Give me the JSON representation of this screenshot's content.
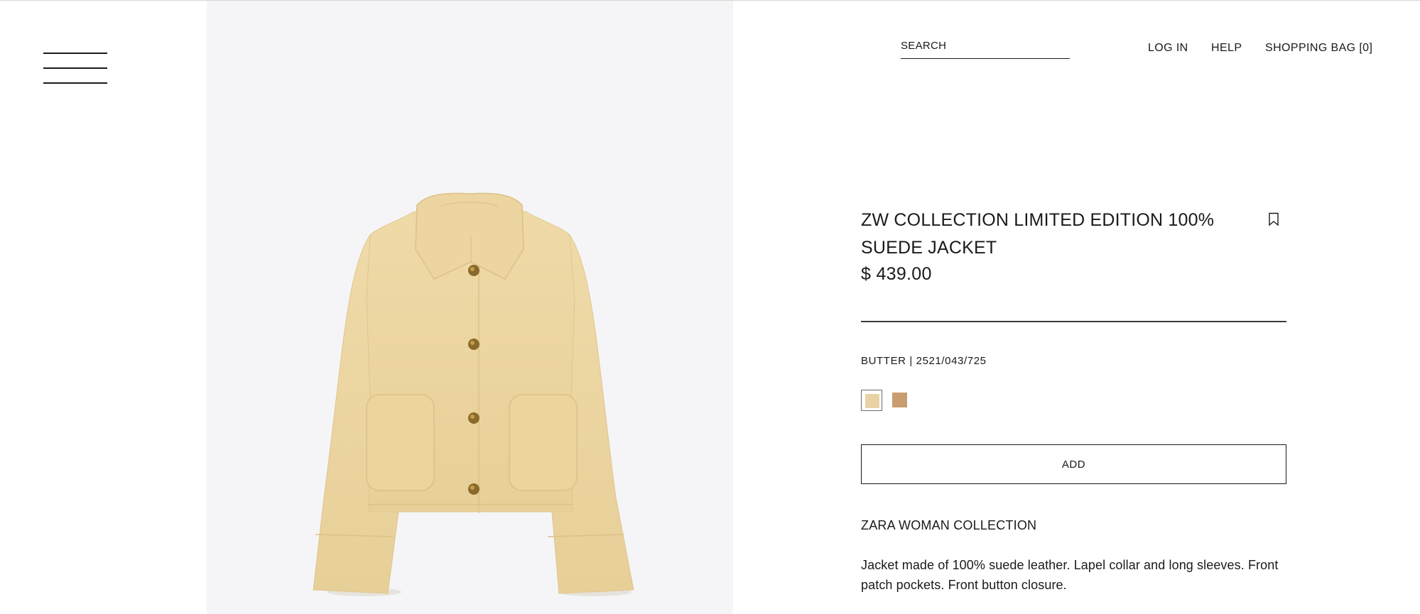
{
  "header": {
    "search_label": "SEARCH",
    "login_label": "LOG IN",
    "help_label": "HELP",
    "bag_label": "SHOPPING BAG [0]"
  },
  "product": {
    "image_alt": "suede-jacket-product-image",
    "title": "ZW COLLECTION LIMITED EDITION 100% SUEDE JACKET",
    "price": "$ 439.00",
    "color_ref": "BUTTER | 2521/043/725",
    "swatches": [
      {
        "name": "butter",
        "color": "#e9d3a6",
        "selected": true
      },
      {
        "name": "tan",
        "color": "#c99c72",
        "selected": false
      }
    ],
    "add_label": "ADD",
    "collection": "ZARA WOMAN COLLECTION",
    "description": "Jacket made of 100% suede leather. Lapel collar and long sleeves. Front patch pockets. Front button closure."
  },
  "colors": {
    "image_background": "#f5f5f7",
    "jacket": "#ecd6a2",
    "button": "#8a6a2a",
    "text": "#1a1a1a"
  }
}
